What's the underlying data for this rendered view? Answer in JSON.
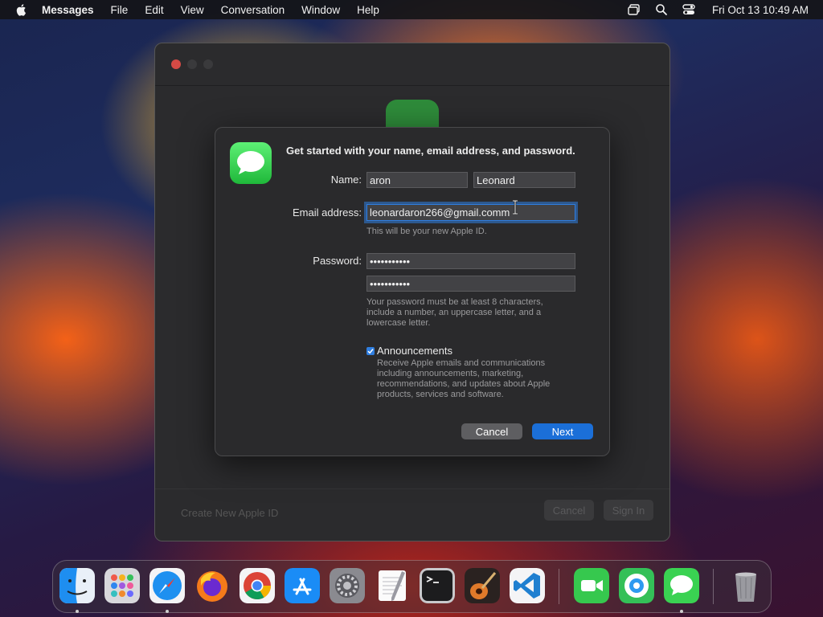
{
  "menubar": {
    "app_name": "Messages",
    "menus": [
      "File",
      "Edit",
      "View",
      "Conversation",
      "Window",
      "Help"
    ],
    "clock": "Fri Oct 13  10:49 AM",
    "status_icons": [
      "screen-mirroring-icon",
      "spotlight-search-icon",
      "control-center-icon"
    ]
  },
  "background_window": {
    "footer_link": "Create New Apple ID",
    "cancel_label": "Cancel",
    "signin_label": "Sign In"
  },
  "dialog": {
    "heading": "Get started with your name, email address, and password.",
    "name_label": "Name:",
    "first_name": "aron",
    "last_name": "Leonard",
    "email_label": "Email address:",
    "email_value": "leonardaron266@gmail.comm",
    "email_hint": "This will be your new Apple ID.",
    "password_label": "Password:",
    "password_value": "•••••••••••",
    "verify_value": "•••••••••••",
    "password_hint": "Your password must be at least 8 characters, include a number, an uppercase letter, and a lowercase letter.",
    "announcements_label": "Announcements",
    "announcements_checked": true,
    "announcements_hint": "Receive Apple emails and communications including announcements, marketing, recommendations, and updates about Apple products, services and software.",
    "cancel_label": "Cancel",
    "next_label": "Next"
  },
  "dock": {
    "items": [
      {
        "name": "finder-icon",
        "running": true
      },
      {
        "name": "launchpad-icon",
        "running": false
      },
      {
        "name": "safari-icon",
        "running": true
      },
      {
        "name": "firefox-icon",
        "running": false
      },
      {
        "name": "chrome-icon",
        "running": false
      },
      {
        "name": "app-store-icon",
        "running": false
      },
      {
        "name": "system-settings-icon",
        "running": false
      },
      {
        "name": "textedit-icon",
        "running": false
      },
      {
        "name": "terminal-icon",
        "running": false
      },
      {
        "name": "garageband-icon",
        "running": false
      },
      {
        "name": "vscode-icon",
        "running": false
      },
      {
        "name": "facetime-icon",
        "running": false
      },
      {
        "name": "find-my-icon",
        "running": false
      },
      {
        "name": "messages-icon",
        "running": true
      },
      {
        "name": "trash-icon",
        "running": false
      }
    ]
  },
  "colors": {
    "accent": "#1b6fd8",
    "messages_green": "#34c84a",
    "dialog_bg": "#2a2a2c"
  }
}
